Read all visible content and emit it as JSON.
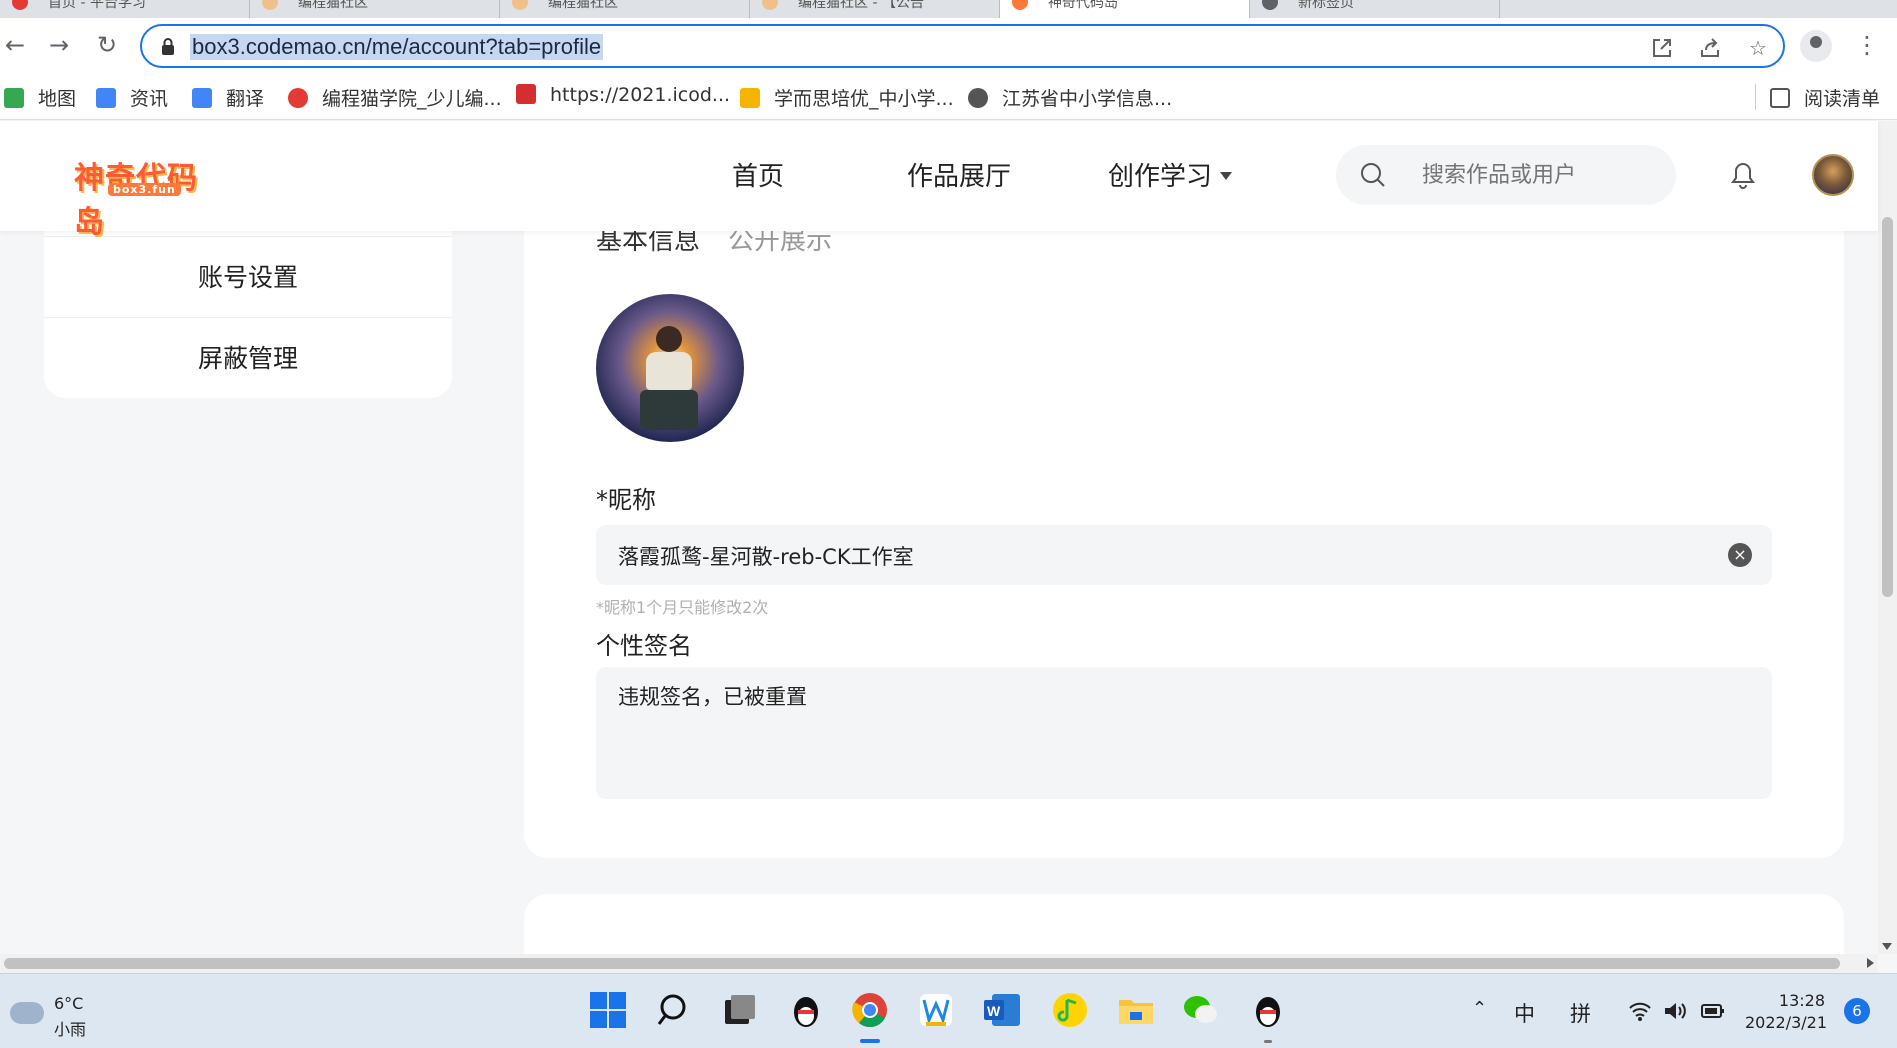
{
  "browser": {
    "tabs": [
      {
        "label": "首页 - 平台学习"
      },
      {
        "label": "编程猫社区"
      },
      {
        "label": "编程猫社区"
      },
      {
        "label": "编程猫社区 - 【公告"
      },
      {
        "label": "神奇代码岛"
      },
      {
        "label": "新标签页"
      }
    ],
    "url": "box3.codemao.cn/me/account?tab=profile",
    "bookmarks": [
      {
        "label": "地图",
        "icon": "maps-icon",
        "color": "#34a853"
      },
      {
        "label": "资讯",
        "icon": "news-icon",
        "color": "#4285f4"
      },
      {
        "label": "翻译",
        "icon": "translate-icon",
        "color": "#4285f4"
      },
      {
        "label": "编程猫学院_少儿编...",
        "icon": "codemao-icon",
        "color": "#e53935"
      },
      {
        "label": "https://2021.icod...",
        "icon": "code-icon",
        "color": "#d32f2f"
      },
      {
        "label": "学而思培优_中小学...",
        "icon": "xueersi-icon",
        "color": "#f4b400"
      },
      {
        "label": "江苏省中小学信息...",
        "icon": "globe-icon",
        "color": "#555555"
      }
    ],
    "reading_list": "阅读清单"
  },
  "site": {
    "logo_text": "神奇代码岛",
    "logo_sub": "box3.fun",
    "nav": {
      "home": "首页",
      "gallery": "作品展厅",
      "learn": "创作学习"
    },
    "search_placeholder": "搜索作品或用户"
  },
  "sidebar": {
    "items": [
      {
        "label": "账号设置"
      },
      {
        "label": "屏蔽管理"
      }
    ]
  },
  "profile": {
    "tab_basic": "基本信息",
    "tab_public": "公开展示",
    "nickname_label": "*昵称",
    "nickname_value": "落霞孤鹜-星河散-reb-CK工作室",
    "nickname_hint": "*昵称1个月只能修改2次",
    "signature_label": "个性签名",
    "signature_value": "违规签名，已被重置"
  },
  "taskbar": {
    "weather_temp": "6°C",
    "weather_cond": "小雨",
    "ime_lang": "中",
    "ime_mode": "拼",
    "time": "13:28",
    "date": "2022/3/21",
    "notifications": "6"
  },
  "colors": {
    "accent": "#1a73e8",
    "brand": "#ff5a36"
  }
}
